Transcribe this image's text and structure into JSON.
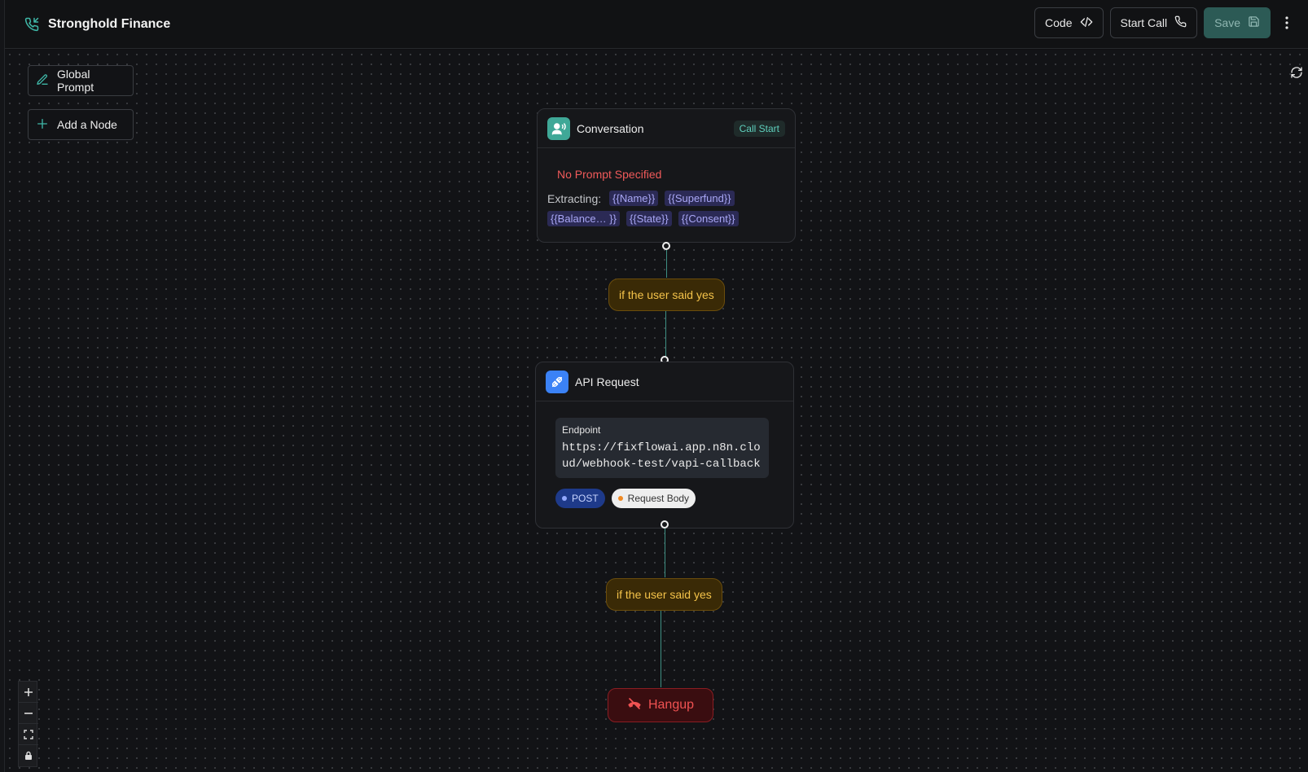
{
  "header": {
    "title": "Stronghold Finance",
    "code_label": "Code",
    "start_call_label": "Start Call",
    "save_label": "Save"
  },
  "sidebar": {
    "global_prompt_label": "Global Prompt",
    "add_node_label": "Add a Node"
  },
  "nodes": {
    "conversation": {
      "title": "Conversation",
      "badge": "Call Start",
      "warning": "No Prompt Specified",
      "extract_label": "Extracting:",
      "variables": [
        "{{Name}}",
        "{{Superfund}}",
        "{{Balance… }}",
        "{{State}}",
        "{{Consent}}"
      ]
    },
    "api_request": {
      "title": "API Request",
      "endpoint_label": "Endpoint",
      "endpoint_url": "https://fixflowai.app.n8n.cloud/webhook-test/vapi-callback",
      "method": "POST",
      "body_label": "Request Body"
    },
    "hangup": {
      "label": "Hangup"
    }
  },
  "edges": {
    "condition_1": "if the user said yes",
    "condition_2": "if the user said yes"
  },
  "colors": {
    "accent_teal": "#3fb8a8",
    "warning_red": "#f05a5a",
    "condition_yellow": "#f4c34a",
    "api_blue": "#3b82f6"
  }
}
